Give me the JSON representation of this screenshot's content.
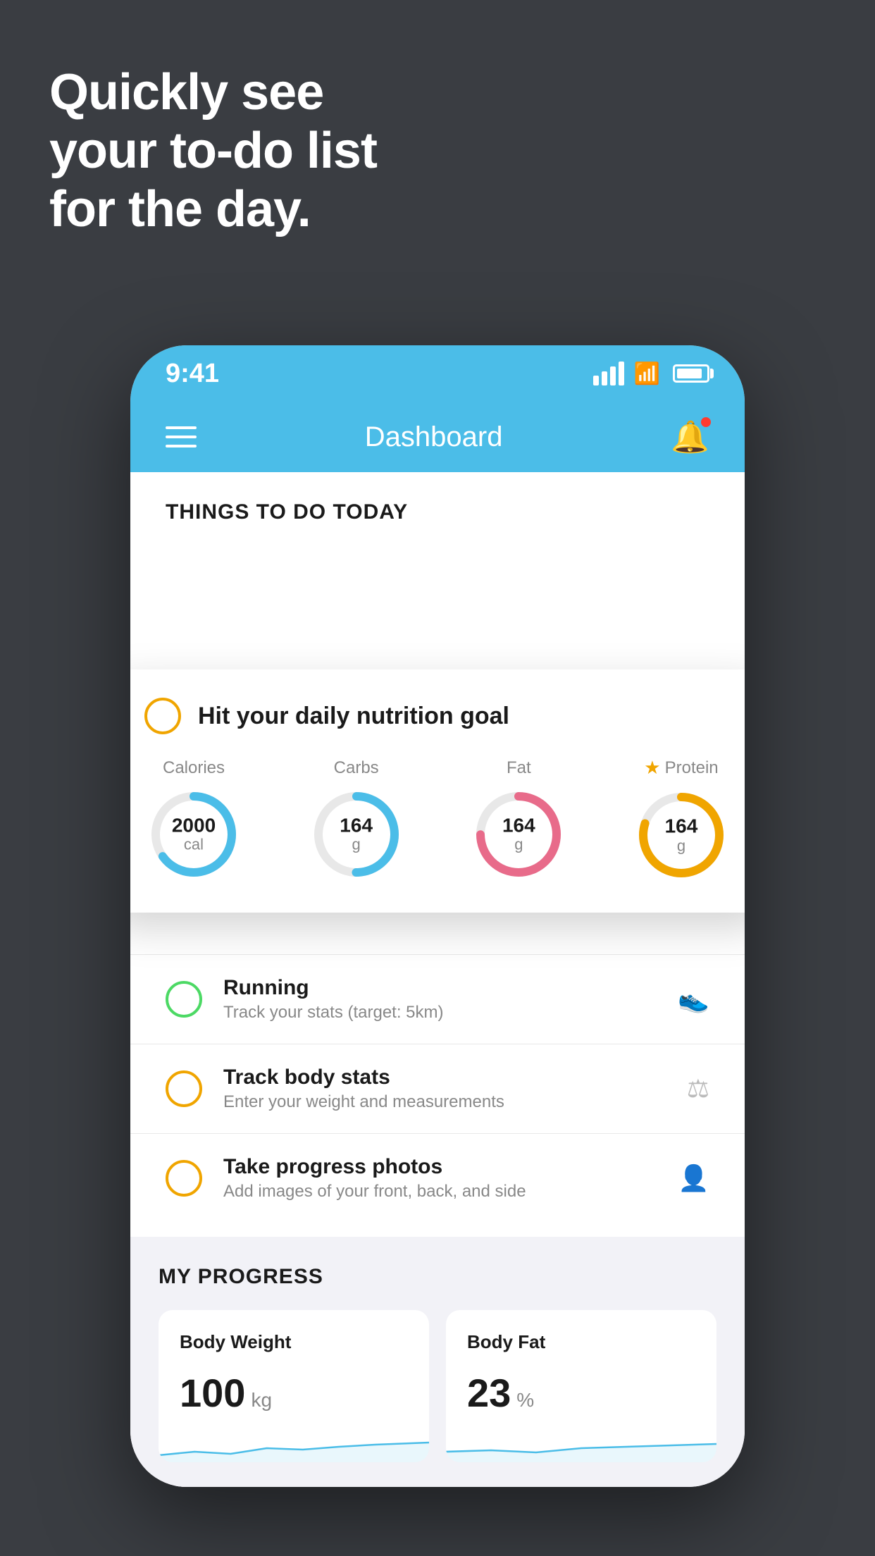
{
  "headline": {
    "line1": "Quickly see",
    "line2": "your to-do list",
    "line3": "for the day."
  },
  "status_bar": {
    "time": "9:41"
  },
  "header": {
    "title": "Dashboard"
  },
  "things_section": {
    "heading": "THINGS TO DO TODAY"
  },
  "nutrition_card": {
    "title": "Hit your daily nutrition goal",
    "items": [
      {
        "label": "Calories",
        "value": "2000",
        "unit": "cal",
        "type": "blue",
        "pct": 65
      },
      {
        "label": "Carbs",
        "value": "164",
        "unit": "g",
        "type": "blue",
        "pct": 50
      },
      {
        "label": "Fat",
        "value": "164",
        "unit": "g",
        "type": "pink",
        "pct": 75
      },
      {
        "label": "Protein",
        "value": "164",
        "unit": "g",
        "type": "yellow",
        "pct": 80,
        "star": true
      }
    ]
  },
  "todo_items": [
    {
      "title": "Running",
      "subtitle": "Track your stats (target: 5km)",
      "circle_color": "green",
      "icon": "shoe"
    },
    {
      "title": "Track body stats",
      "subtitle": "Enter your weight and measurements",
      "circle_color": "yellow",
      "icon": "scale"
    },
    {
      "title": "Take progress photos",
      "subtitle": "Add images of your front, back, and side",
      "circle_color": "yellow",
      "icon": "person"
    }
  ],
  "progress_section": {
    "heading": "MY PROGRESS",
    "cards": [
      {
        "title": "Body Weight",
        "value": "100",
        "unit": "kg"
      },
      {
        "title": "Body Fat",
        "value": "23",
        "unit": "%"
      }
    ]
  }
}
